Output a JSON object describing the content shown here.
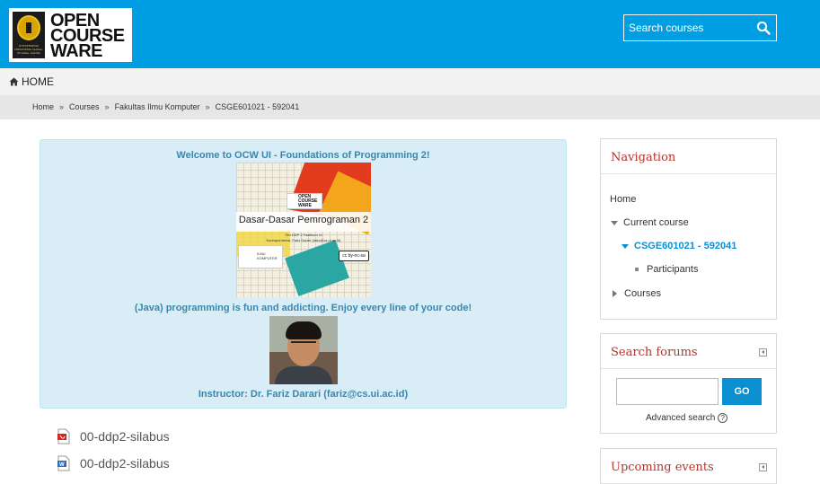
{
  "header": {
    "logo_lines": [
      "OPEN",
      "COURSE",
      "WARE"
    ],
    "logo_seal_text": "UNIVERSITAS INDONESIA Veritas, Probitas, Iustitia",
    "search_placeholder": "Search courses",
    "search_icon": "search-icon",
    "color": "#009fe3"
  },
  "nav": {
    "home_label": "HOME",
    "home_icon": "home-icon"
  },
  "breadcrumb": {
    "items": [
      "Home",
      "Courses",
      "Fakultas Ilmu Komputer",
      "CSGE601021 - 592041"
    ],
    "separator": "»"
  },
  "welcome": {
    "title": "Welcome to OCW UI - Foundations of Programming 2!",
    "banner": {
      "logo_text": "OPEN COURSE WARE",
      "course_title": "Dasar-Dasar Pemrograman 2",
      "team_line": "Tim DDP 2 Fasilkom UI",
      "contact_line": "Korespondensi: Fariz Darari (fariz@cs.ui.ac.id)",
      "faculty_text": "ILMU KOMPUTER",
      "license_badge": "cc by-nc-sa"
    },
    "tagline": "(Java) programming is fun and addicting. Enjoy every line of your code!",
    "instructor": "Instructor: Dr. Fariz Darari (fariz@cs.ui.ac.id)"
  },
  "files": [
    {
      "name": "00-ddp2-silabus",
      "icon": "pdf-file-icon"
    },
    {
      "name": "00-ddp2-silabus",
      "icon": "word-file-icon"
    }
  ],
  "navigation_block": {
    "title": "Navigation",
    "home": "Home",
    "current_course": "Current course",
    "course_code": "CSGE601021 - 592041",
    "participants": "Participants",
    "courses": "Courses"
  },
  "forum_block": {
    "title": "Search forums",
    "go_label": "GO",
    "advanced_label": "Advanced search",
    "help_symbol": "?"
  },
  "events_block": {
    "title": "Upcoming events"
  }
}
